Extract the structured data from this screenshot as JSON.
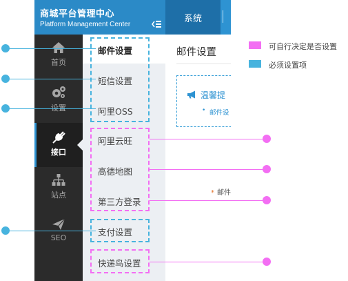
{
  "header": {
    "app_title": "商城平台管理中心",
    "app_subtitle": "Platform Management Center",
    "menu_toggle_glyph": "⇠≡",
    "active_tab": "系统"
  },
  "sidebar": {
    "items": [
      {
        "label": "首页",
        "icon": "home-icon"
      },
      {
        "label": "设置",
        "icon": "gears-icon"
      },
      {
        "label": "接口",
        "icon": "plug-icon",
        "active": true
      },
      {
        "label": "站点",
        "icon": "sitemap-icon"
      },
      {
        "label": "SEO",
        "icon": "paper-plane-icon"
      }
    ]
  },
  "submenu": {
    "items": [
      {
        "label": "邮件设置",
        "active": true
      },
      {
        "label": "短信设置"
      },
      {
        "label": "阿里OSS"
      },
      {
        "label": "阿里云旺"
      },
      {
        "label": "高德地图"
      },
      {
        "label": "第三方登录"
      },
      {
        "label": "支付设置"
      },
      {
        "label": "快递鸟设置"
      }
    ]
  },
  "content": {
    "page_title": "邮件设置",
    "notice_title": "温馨提",
    "notice_item": "邮件设",
    "field_required_mark": "*",
    "field_label": "邮件"
  },
  "legend": {
    "optional": {
      "label": "可自行决定是否设置",
      "color": "#f36ef3"
    },
    "required": {
      "label": "必须设置项",
      "color": "#47b3de"
    }
  },
  "colors": {
    "brand": "#2b8ac7",
    "sidebar_bg": "#2b2b2b",
    "submenu_bg": "#eceff3",
    "accent": "#2e93d2"
  }
}
